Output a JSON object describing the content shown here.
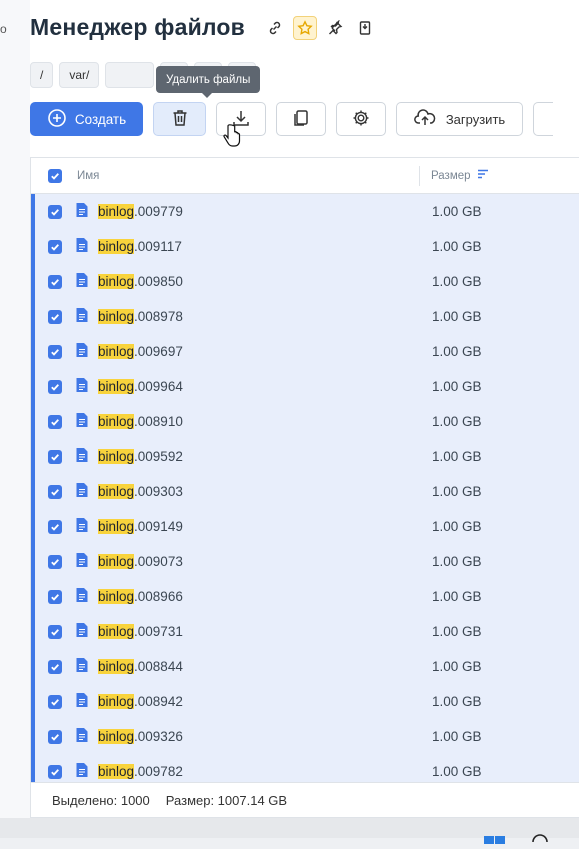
{
  "rail": {
    "glyph": "o"
  },
  "header": {
    "title": "Менеджер файлов",
    "icons": [
      "link-icon",
      "star-icon",
      "pin-icon",
      "bookmark-icon"
    ]
  },
  "breadcrumb": {
    "root": "/",
    "segment": "var/"
  },
  "tooltip": {
    "text": "Удалить файлы"
  },
  "toolbar": {
    "create_label": "Создать",
    "upload_label": "Загрузить"
  },
  "table": {
    "col_name": "Имя",
    "col_size": "Размер",
    "highlight": "binlog",
    "rows": [
      {
        "suffix": ".009779",
        "size": "1.00 GB"
      },
      {
        "suffix": ".009117",
        "size": "1.00 GB"
      },
      {
        "suffix": ".009850",
        "size": "1.00 GB"
      },
      {
        "suffix": ".008978",
        "size": "1.00 GB"
      },
      {
        "suffix": ".009697",
        "size": "1.00 GB"
      },
      {
        "suffix": ".009964",
        "size": "1.00 GB"
      },
      {
        "suffix": ".008910",
        "size": "1.00 GB"
      },
      {
        "suffix": ".009592",
        "size": "1.00 GB"
      },
      {
        "suffix": ".009303",
        "size": "1.00 GB"
      },
      {
        "suffix": ".009149",
        "size": "1.00 GB"
      },
      {
        "suffix": ".009073",
        "size": "1.00 GB"
      },
      {
        "suffix": ".008966",
        "size": "1.00 GB"
      },
      {
        "suffix": ".009731",
        "size": "1.00 GB"
      },
      {
        "suffix": ".008844",
        "size": "1.00 GB"
      },
      {
        "suffix": ".008942",
        "size": "1.00 GB"
      },
      {
        "suffix": ".009326",
        "size": "1.00 GB"
      },
      {
        "suffix": ".009782",
        "size": "1.00 GB"
      }
    ]
  },
  "footer": {
    "selected": "Выделено: 1000",
    "size": "Размер: 1007.14 GB"
  },
  "colors": {
    "accent": "#3f77e6",
    "row_bg": "#e8eefb",
    "highlight": "#f8d33c"
  }
}
